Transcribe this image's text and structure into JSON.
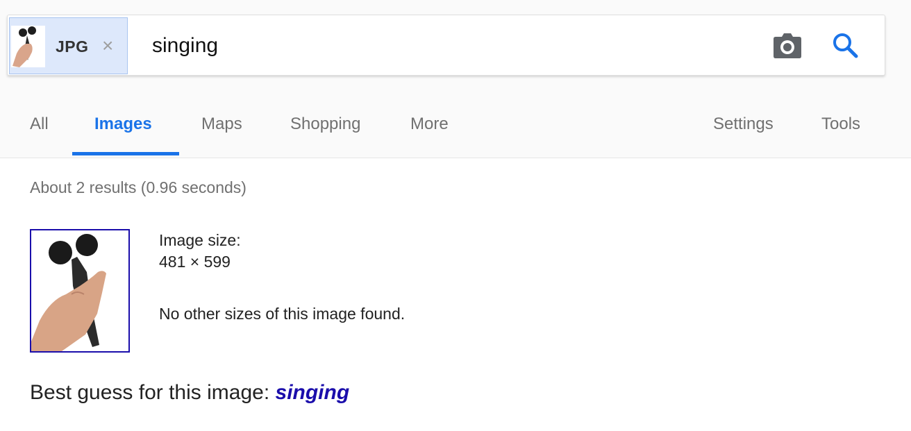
{
  "search": {
    "image_chip_label": "JPG",
    "close_symbol": "×",
    "query": "singing",
    "camera_icon": "camera-icon",
    "search_icon": "search-icon"
  },
  "tabs": {
    "all": "All",
    "images": "Images",
    "maps": "Maps",
    "shopping": "Shopping",
    "more": "More",
    "settings": "Settings",
    "tools": "Tools",
    "active": "Images"
  },
  "results": {
    "stats": "About 2 results (0.96 seconds)",
    "image_size_label": "Image size:",
    "image_size_value": "481 × 599",
    "other_sizes_note": "No other sizes of this image found.",
    "best_guess_prefix": "Best guess for this image:",
    "best_guess_link": "singing"
  },
  "colors": {
    "accent": "#1a73e8",
    "link": "#1a0dab",
    "chip_bg": "#dde8fb",
    "icon_gray": "#5f6368"
  }
}
